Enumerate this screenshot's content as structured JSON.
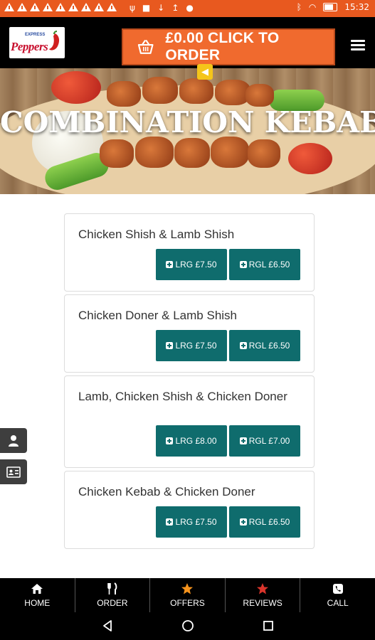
{
  "status_bar": {
    "time": "15:32"
  },
  "header": {
    "logo_text": "Peppers",
    "logo_subtext": "EXPRESS",
    "order_button_label": "£0.00 CLICK TO ORDER"
  },
  "hero": {
    "title": "COMBINATION KEBABS"
  },
  "menu_items": [
    {
      "name": "Chicken Shish & Lamb Shish",
      "large_label": "LRG £7.50",
      "regular_label": "RGL £6.50"
    },
    {
      "name": "Chicken Doner & Lamb Shish",
      "large_label": "LRG £7.50",
      "regular_label": "RGL £6.50"
    },
    {
      "name": "Lamb, Chicken Shish & Chicken Doner",
      "large_label": "LRG £8.00",
      "regular_label": "RGL £7.00"
    },
    {
      "name": "Chicken Kebab & Chicken Doner",
      "large_label": "LRG £7.50",
      "regular_label": "RGL £6.50"
    }
  ],
  "bottom_nav": [
    {
      "label": "HOME",
      "icon": "home-icon"
    },
    {
      "label": "ORDER",
      "icon": "cutlery-icon"
    },
    {
      "label": "OFFERS",
      "icon": "star-icon"
    },
    {
      "label": "REVIEWS",
      "icon": "star-icon"
    },
    {
      "label": "CALL",
      "icon": "phone-icon"
    }
  ],
  "colors": {
    "status_bar": "#e8591f",
    "order_button": "#f06a2e",
    "price_button": "#0f6c6d",
    "offers_star": "#f7941d",
    "reviews_star": "#d9342b"
  }
}
